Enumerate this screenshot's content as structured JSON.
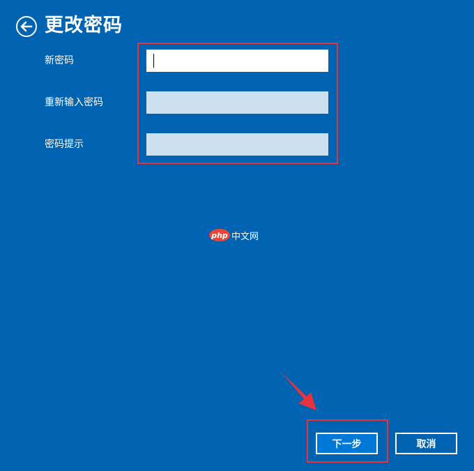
{
  "page": {
    "title": "更改密码"
  },
  "form": {
    "fields": [
      {
        "label": "新密码",
        "value": ""
      },
      {
        "label": "重新输入密码",
        "value": ""
      },
      {
        "label": "密码提示",
        "value": ""
      }
    ]
  },
  "buttons": {
    "next": "下一步",
    "cancel": "取消"
  },
  "watermark": {
    "logo": "php",
    "text": "中文网"
  },
  "icons": {
    "back": "arrow-left-circle-icon"
  },
  "colors": {
    "background": "#0063B1",
    "primary_button": "#0078D7",
    "annotation": "#E8323C",
    "inactive_field": "#CCE0EF",
    "watermark_logo": "#E8463A"
  }
}
